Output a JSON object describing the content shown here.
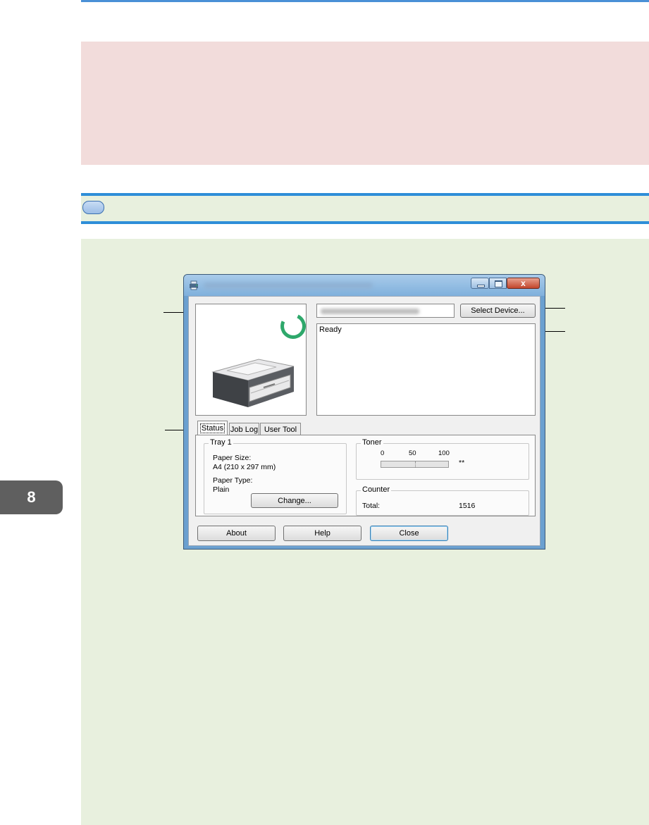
{
  "page": {
    "chapter_number": "8",
    "pink_box_text": "",
    "green_bar_text": ""
  },
  "window": {
    "title": "",
    "close_glyph": "x"
  },
  "app": {
    "device_name": "",
    "select_device_label": "Select Device...",
    "status_text": "Ready",
    "tabs": [
      {
        "label": "Status",
        "active": true
      },
      {
        "label": "Job Log",
        "active": false
      },
      {
        "label": "User Tool",
        "active": false
      }
    ],
    "tray": {
      "title": "Tray 1",
      "paper_size_label": "Paper Size:",
      "paper_size_value": "A4 (210 x 297 mm)",
      "paper_type_label": "Paper Type:",
      "paper_type_value": "Plain",
      "change_label": "Change..."
    },
    "toner": {
      "title": "Toner",
      "scale": [
        "0",
        "50",
        "100"
      ],
      "level_text": "**"
    },
    "counter": {
      "title": "Counter",
      "total_label": "Total:",
      "total_value": "1516"
    },
    "buttons": {
      "about": "About",
      "help": "Help",
      "close": "Close"
    }
  },
  "colors": {
    "accent_blue": "#2e8ed8",
    "note_pink": "#f2dcdb",
    "note_green": "#e8f0de",
    "status_ready_green": "#2ea86b"
  }
}
